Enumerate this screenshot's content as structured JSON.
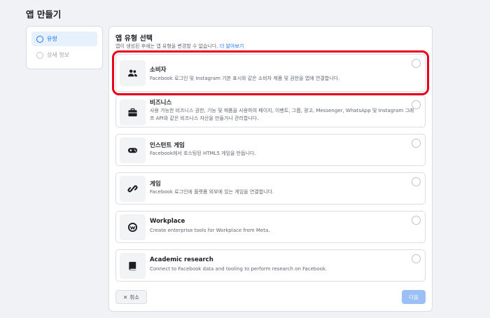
{
  "page": {
    "title": "앱 만들기"
  },
  "steps": [
    {
      "label": "유형",
      "active": true
    },
    {
      "label": "상세 정보",
      "active": false
    }
  ],
  "panel": {
    "title": "앱 유형 선택",
    "subtitle": "앱이 생성된 후에는 앱 유형을 변경할 수 없습니다.",
    "learn_more": "더 알아보기"
  },
  "app_types": [
    {
      "title": "소비자",
      "description": "Facebook 로그인 및 Instagram 기본 표시와 같은 소비자 제품 및 권한을 앱에 연결합니다.",
      "icon": "people-icon",
      "selected": true
    },
    {
      "title": "비즈니스",
      "description": "사용 가능한 비즈니스 권한, 기능 및 제품을 사용하여 페이지, 이벤트, 그룹, 광고, Messenger, WhatsApp 및 Instagram 그래프 API와 같은 비즈니스 자산을 만들거나 관리합니다.",
      "icon": "briefcase-icon",
      "selected": false
    },
    {
      "title": "인스턴트 게임",
      "description": "Facebook에서 호스팅된 HTML5 게임을 만듭니다.",
      "icon": "gamepad-icon",
      "selected": false
    },
    {
      "title": "게임",
      "description": "Facebook 로그인에 플랫폼 외부에 있는 게임을 연결합니다.",
      "icon": "link-icon",
      "selected": false
    },
    {
      "title": "Workplace",
      "description": "Create enterprise tools for Workplace from Meta.",
      "icon": "workplace-icon",
      "selected": false
    },
    {
      "title": "Academic research",
      "description": "Connect to Facebook data and tooling to perform research on Facebook.",
      "icon": "notebook-icon",
      "selected": false
    }
  ],
  "buttons": {
    "cancel": "취소",
    "next": "다음"
  },
  "colors": {
    "accent": "#1877f2",
    "highlight": "#e8001c",
    "next_disabled": "#9bc0f7"
  }
}
